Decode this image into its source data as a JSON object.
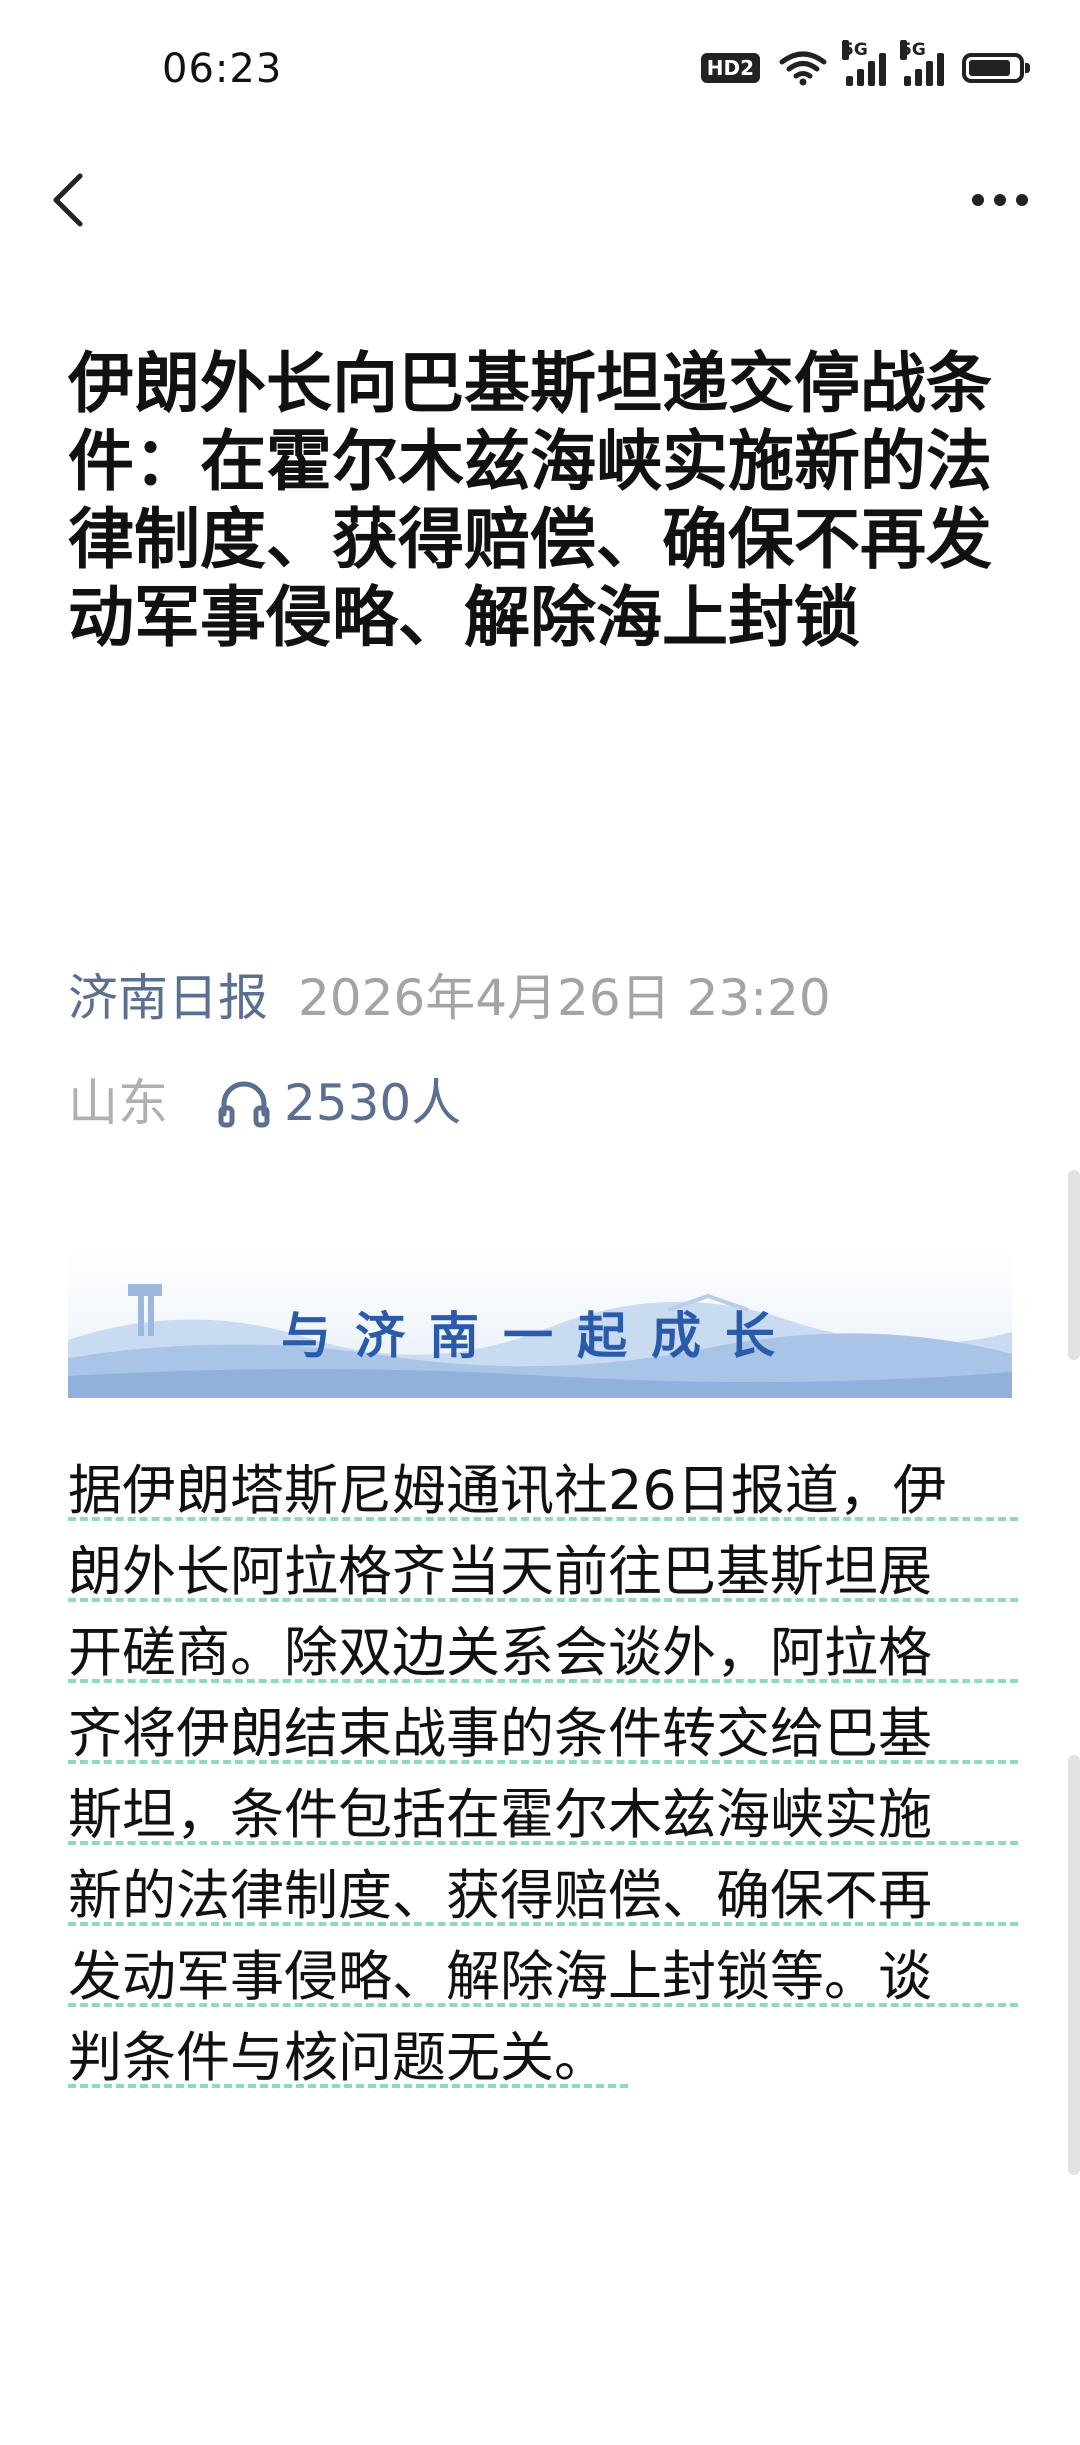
{
  "status_bar": {
    "time": "06:23",
    "hd_badge": "HD2",
    "signal1_label": "5G",
    "signal2_label": "5G",
    "battery_level": 0.85
  },
  "nav": {
    "back_icon": "chevron-left-icon",
    "more_icon": "more-dots-icon"
  },
  "article": {
    "title": "伊朗外长向巴基斯坦递交停战条件：在霍尔木兹海峡实施新的法律制度、获得赔偿、确保不再发动军事侵略、解除海上封锁",
    "source": "济南日报",
    "date": "2026年4月26日 23:20",
    "region": "山东",
    "listen_count": "2530人",
    "banner_text": "与济南一起成长",
    "body_lines": [
      "据伊朗塔斯尼姆通讯社26日报道，伊",
      "朗外长阿拉格齐当天前往巴基斯坦展",
      "开磋商。除双边关系会谈外，阿拉格",
      "齐将伊朗结束战事的条件转交给巴基",
      "斯坦，条件包括在霍尔木兹海峡实施",
      "新的法律制度、获得赔偿、确保不再",
      "发动军事侵略、解除海上封锁等。谈",
      "判条件与核问题无关。"
    ]
  },
  "colors": {
    "source_link": "#5b6f91",
    "meta_gray": "#a4a4a4",
    "banner_text": "#2a5baa",
    "underline": "#8fd9c2"
  }
}
